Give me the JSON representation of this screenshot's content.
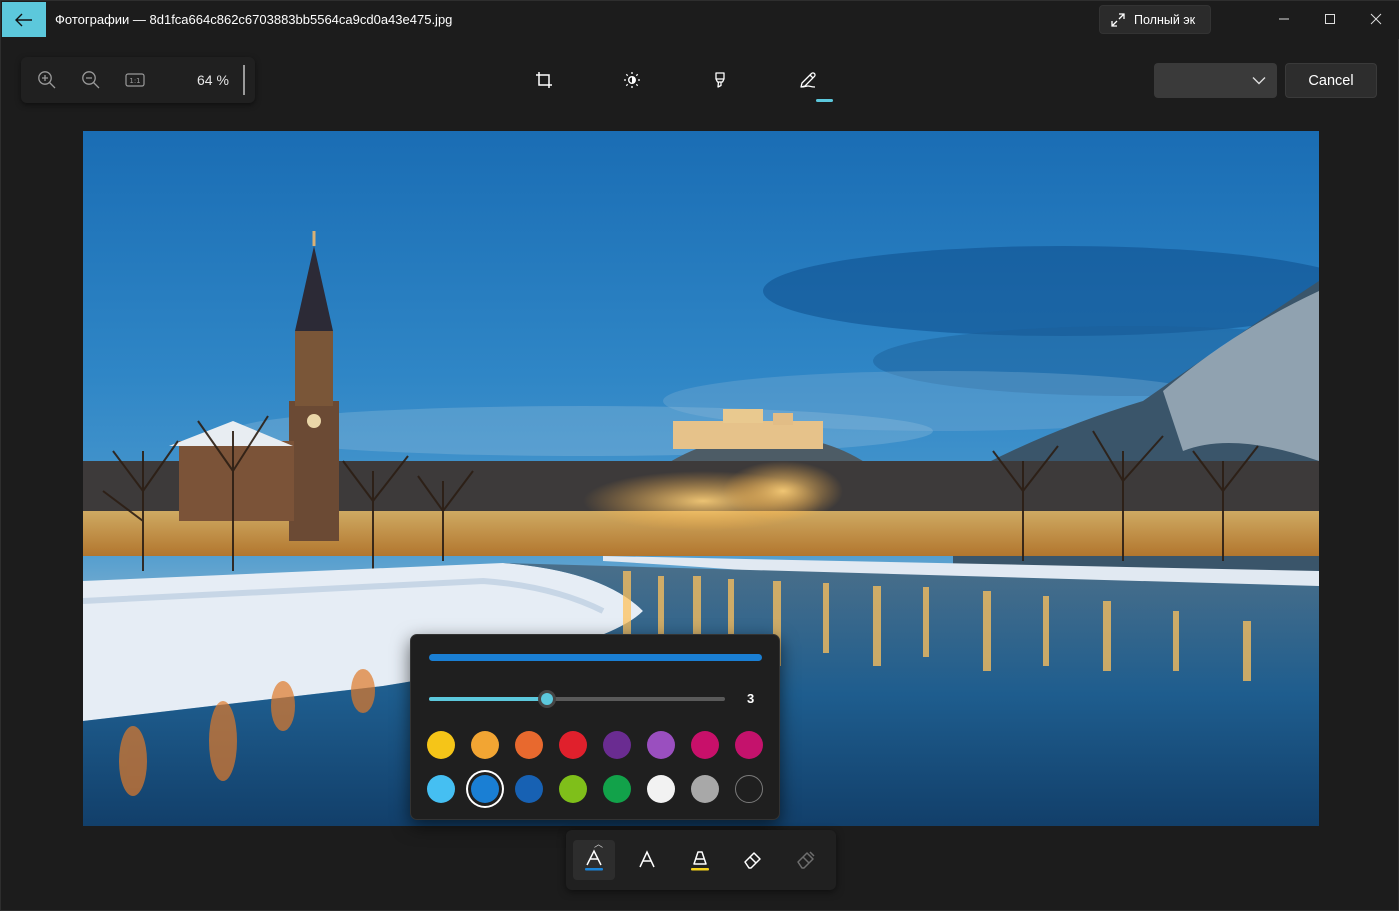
{
  "window": {
    "title": "Фотографии — 8d1fca664c862c6703883bb5564ca9cd0a43e475.jpg",
    "fullscreen_label": "Полный эк",
    "accent_color": "#5cc8dc"
  },
  "icons": {
    "back": "arrow-left-icon",
    "fullscreen": "expand-diagonal-icon",
    "minimize": "minimize-icon",
    "maximize": "maximize-icon",
    "close": "close-icon"
  },
  "toolbar": {
    "zoom_in_icon": "zoom-in-icon",
    "zoom_out_icon": "zoom-out-icon",
    "actual_size_icon": "actual-size-icon",
    "zoom_level": "64 %",
    "tools": [
      {
        "name": "crop",
        "icon": "crop-icon",
        "active": false
      },
      {
        "name": "adjust",
        "icon": "brightness-icon",
        "active": false
      },
      {
        "name": "filter",
        "icon": "marker-icon",
        "active": false
      },
      {
        "name": "markup",
        "icon": "pen-icon",
        "active": true
      }
    ],
    "save_dropdown_value": "",
    "cancel_label": "Cancel"
  },
  "pen_flyout": {
    "stroke_color": "#1a7fd4",
    "size_fraction": 0.4,
    "size_value": "3",
    "colors_row1": [
      "#f5c518",
      "#f2a533",
      "#e8692e",
      "#e0202c",
      "#6a2c91",
      "#9a4fbf",
      "#c8106a",
      "#c4126c"
    ],
    "colors_row2": [
      "#45bff2",
      "#1a7fd4",
      "#1761b3",
      "#7fbf1a",
      "#12a24a",
      "#f2f2f2",
      "#a8a8a8",
      "transparent"
    ],
    "selected_color": "#1a7fd4"
  },
  "draw_tools": [
    {
      "name": "ballpoint-pen",
      "icon": "pen-underlined-icon",
      "underline": "#1a84d8",
      "active": true
    },
    {
      "name": "pencil",
      "icon": "pen-tip-icon",
      "underline": "",
      "active": false
    },
    {
      "name": "highlighter",
      "icon": "highlighter-icon",
      "underline": "#f5d21c",
      "active": false
    },
    {
      "name": "eraser",
      "icon": "eraser-icon",
      "underline": "",
      "active": false
    },
    {
      "name": "erase-all",
      "icon": "erase-all-icon",
      "underline": "",
      "active": false
    }
  ]
}
